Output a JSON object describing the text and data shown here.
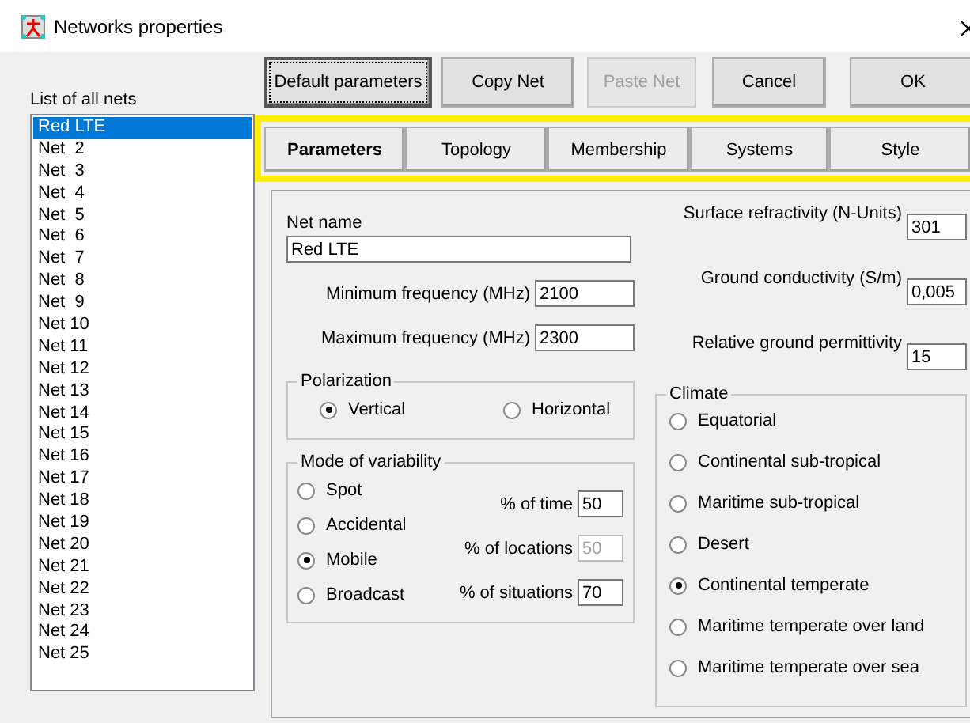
{
  "window": {
    "title": "Networks properties"
  },
  "nets": {
    "label": "List of all nets",
    "items": [
      {
        "label": "Red LTE",
        "selected": true
      },
      {
        "label": "Net  2",
        "selected": false
      },
      {
        "label": "Net  3",
        "selected": false
      },
      {
        "label": "Net  4",
        "selected": false
      },
      {
        "label": "Net  5",
        "selected": false
      },
      {
        "label": "Net  6",
        "selected": false
      },
      {
        "label": "Net  7",
        "selected": false
      },
      {
        "label": "Net  8",
        "selected": false
      },
      {
        "label": "Net  9",
        "selected": false
      },
      {
        "label": "Net 10",
        "selected": false
      },
      {
        "label": "Net 11",
        "selected": false
      },
      {
        "label": "Net 12",
        "selected": false
      },
      {
        "label": "Net 13",
        "selected": false
      },
      {
        "label": "Net 14",
        "selected": false
      },
      {
        "label": "Net 15",
        "selected": false
      },
      {
        "label": "Net 16",
        "selected": false
      },
      {
        "label": "Net 17",
        "selected": false
      },
      {
        "label": "Net 18",
        "selected": false
      },
      {
        "label": "Net 19",
        "selected": false
      },
      {
        "label": "Net 20",
        "selected": false
      },
      {
        "label": "Net 21",
        "selected": false
      },
      {
        "label": "Net 22",
        "selected": false
      },
      {
        "label": "Net 23",
        "selected": false
      },
      {
        "label": "Net 24",
        "selected": false
      },
      {
        "label": "Net 25",
        "selected": false
      }
    ]
  },
  "buttons": [
    {
      "label": "Default parameters",
      "disabled": false,
      "focused": true
    },
    {
      "label": "Copy Net",
      "disabled": false,
      "focused": false
    },
    {
      "label": "Paste Net",
      "disabled": true,
      "focused": false
    },
    {
      "label": "Cancel",
      "disabled": false,
      "focused": false
    },
    {
      "label": "OK",
      "disabled": false,
      "focused": false
    }
  ],
  "tabs": [
    {
      "label": "Parameters",
      "selected": true
    },
    {
      "label": "Topology",
      "selected": false
    },
    {
      "label": "Membership",
      "selected": false
    },
    {
      "label": "Systems",
      "selected": false
    },
    {
      "label": "Style",
      "selected": false
    }
  ],
  "net_name": {
    "label": "Net name",
    "value": "Red LTE"
  },
  "frequencies": [
    {
      "label": "Minimum frequency (MHz)",
      "value": "2100"
    },
    {
      "label": "Maximum frequency (MHz)",
      "value": "2300"
    }
  ],
  "ground": [
    {
      "label": "Surface refractivity (N-Units)",
      "value": "301"
    },
    {
      "label": "Ground conductivity (S/m)",
      "value": "0,005"
    },
    {
      "label": "Relative ground permittivity",
      "value": "15"
    }
  ],
  "polarization": {
    "title": "Polarization",
    "options": [
      {
        "label": "Vertical",
        "selected": true
      },
      {
        "label": "Horizontal",
        "selected": false
      }
    ]
  },
  "variability": {
    "title": "Mode of variability",
    "options": [
      {
        "label": "Spot",
        "selected": false
      },
      {
        "label": "Accidental",
        "selected": false
      },
      {
        "label": "Mobile",
        "selected": true
      },
      {
        "label": "Broadcast",
        "selected": false
      }
    ],
    "fields": [
      {
        "label": "% of time",
        "value": "50",
        "disabled": false
      },
      {
        "label": "% of locations",
        "value": "50",
        "disabled": true
      },
      {
        "label": "% of situations",
        "value": "70",
        "disabled": false
      }
    ]
  },
  "climate": {
    "title": "Climate",
    "options": [
      {
        "label": "Equatorial",
        "selected": false
      },
      {
        "label": "Continental sub-tropical",
        "selected": false
      },
      {
        "label": "Maritime sub-tropical",
        "selected": false
      },
      {
        "label": "Desert",
        "selected": false
      },
      {
        "label": "Continental temperate",
        "selected": true
      },
      {
        "label": "Maritime temperate over land",
        "selected": false
      },
      {
        "label": "Maritime temperate over sea",
        "selected": false
      }
    ]
  }
}
